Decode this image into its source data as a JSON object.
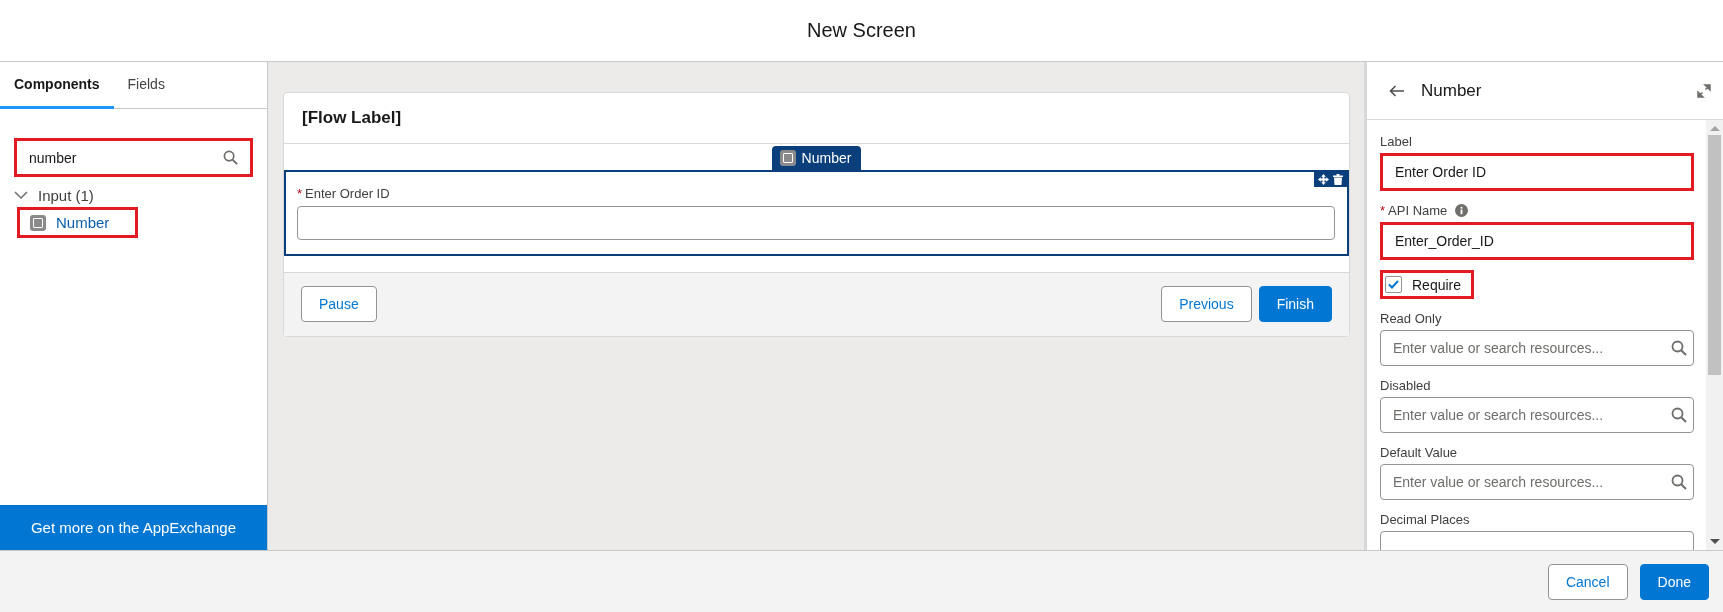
{
  "window": {
    "title": "New Screen"
  },
  "left_panel": {
    "tabs": [
      {
        "label": "Components",
        "selected": true
      },
      {
        "label": "Fields",
        "selected": false
      }
    ],
    "search": {
      "value": "number",
      "highlighted": true
    },
    "tree": [
      {
        "label": "Input (1)",
        "expanded": true,
        "children": [
          {
            "label": "Number",
            "highlighted": true
          }
        ]
      }
    ],
    "appexchange_button": "Get more on the AppExchange"
  },
  "canvas": {
    "header": "[Flow Label]",
    "component_tab": "Number",
    "field": {
      "label": "Enter Order ID",
      "required_mark": "*"
    },
    "buttons": [
      {
        "label": "Pause",
        "primary": false
      },
      {
        "label": "Previous",
        "primary": false
      },
      {
        "label": "Finish",
        "primary": true
      }
    ]
  },
  "properties": {
    "title": "Number",
    "fields": [
      {
        "kind": "text",
        "label": "Label",
        "value": "Enter Order ID",
        "highlighted": true
      },
      {
        "kind": "text",
        "label": "API Name",
        "value": "Enter_Order_ID",
        "required_mark": "*",
        "info": true,
        "highlighted": true
      },
      {
        "kind": "checkbox",
        "label": "Require",
        "checked": true,
        "highlighted": true
      },
      {
        "kind": "resource",
        "label": "Read Only",
        "placeholder": "Enter value or search resources..."
      },
      {
        "kind": "resource",
        "label": "Disabled",
        "placeholder": "Enter value or search resources..."
      },
      {
        "kind": "resource",
        "label": "Default Value",
        "placeholder": "Enter value or search resources..."
      },
      {
        "kind": "text",
        "label": "Decimal Places",
        "highlighted": false
      }
    ]
  },
  "footer": {
    "buttons": [
      {
        "label": "Cancel",
        "primary": false
      },
      {
        "label": "Done",
        "primary": true
      }
    ]
  }
}
